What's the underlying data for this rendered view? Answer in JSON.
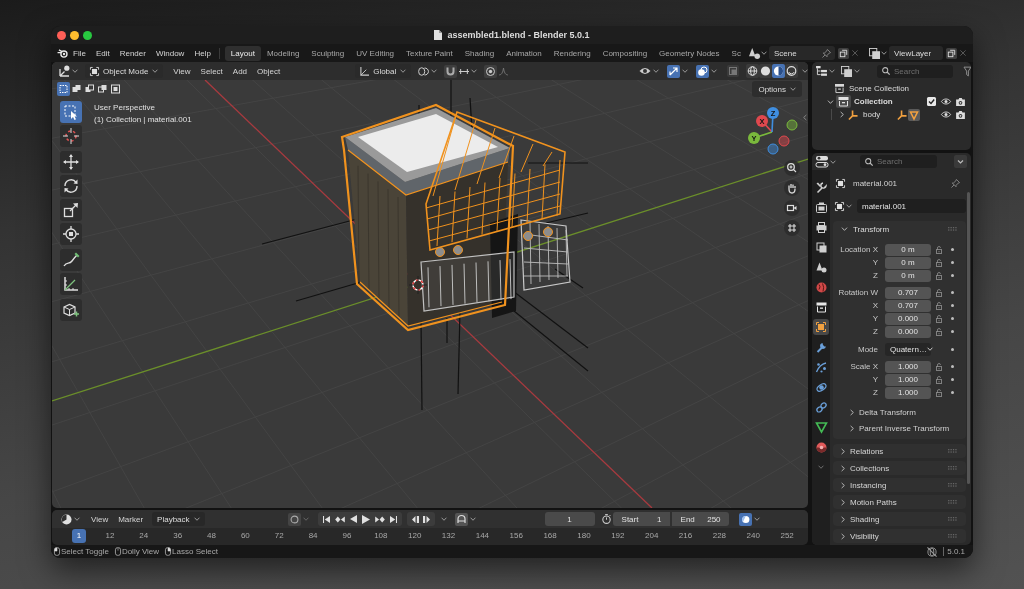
{
  "window": {
    "title": "assembled1.blend - Blender 5.0.1"
  },
  "menu_bar": {
    "menus": [
      "File",
      "Edit",
      "Render",
      "Window",
      "Help"
    ],
    "workspaces": [
      {
        "label": "Layout",
        "selected": true
      },
      {
        "label": "Modeling",
        "selected": false
      },
      {
        "label": "Sculpting",
        "selected": false
      },
      {
        "label": "UV Editing",
        "selected": false
      },
      {
        "label": "Texture Paint",
        "selected": false
      },
      {
        "label": "Shading",
        "selected": false
      },
      {
        "label": "Animation",
        "selected": false
      },
      {
        "label": "Rendering",
        "selected": false
      },
      {
        "label": "Compositing",
        "selected": false
      },
      {
        "label": "Geometry Nodes",
        "selected": false
      },
      {
        "label": "Sc",
        "selected": false
      }
    ],
    "scene": "Scene",
    "view_layer": "ViewLayer"
  },
  "viewport": {
    "header": {
      "mode": "Object Mode",
      "menus": [
        "View",
        "Select",
        "Add",
        "Object"
      ],
      "orientation": "Global",
      "toggles": [
        {
          "kind": "gizmos",
          "on": true
        },
        {
          "kind": "overlays",
          "on": true
        },
        {
          "kind": "xray",
          "on": false
        }
      ],
      "shading_modes": [
        {
          "kind": "wireframe",
          "selected": false
        },
        {
          "kind": "solid",
          "selected": false
        },
        {
          "kind": "material",
          "selected": true
        },
        {
          "kind": "rendered",
          "selected": false
        }
      ]
    },
    "selection_modes": [
      {
        "kind": "set",
        "selected": true
      },
      {
        "kind": "extend",
        "selected": false
      },
      {
        "kind": "subtract",
        "selected": false
      },
      {
        "kind": "invert",
        "selected": false
      },
      {
        "kind": "intersect",
        "selected": false
      }
    ],
    "options": "Options",
    "info": [
      "User Perspective",
      "(1) Collection | material.001"
    ],
    "tool_groups": [
      {
        "tools": [
          {
            "kind": "select-box",
            "selected": true
          },
          {
            "kind": "cursor",
            "selected": false
          }
        ]
      },
      {
        "tools": [
          {
            "kind": "move",
            "selected": false
          },
          {
            "kind": "rotate",
            "selected": false
          },
          {
            "kind": "scale",
            "selected": false
          },
          {
            "kind": "transform",
            "selected": false
          }
        ]
      },
      {
        "tools": [
          {
            "kind": "annotate",
            "selected": false
          },
          {
            "kind": "measure",
            "selected": false
          }
        ]
      },
      {
        "tools": [
          {
            "kind": "add-cube",
            "selected": false
          }
        ]
      }
    ],
    "gizmo_axes": [
      "X",
      "Y",
      "Z"
    ]
  },
  "timeline": {
    "menus": [
      "View",
      "Marker"
    ],
    "playback": "Playback",
    "current_frame": "1",
    "start_label": "Start",
    "start": "1",
    "end_label": "End",
    "end": "250",
    "playhead": "1",
    "ruler": [
      "12",
      "24",
      "36",
      "48",
      "60",
      "72",
      "84",
      "96",
      "108",
      "120",
      "132",
      "144",
      "156",
      "168",
      "180",
      "192",
      "204",
      "216",
      "228",
      "240",
      "252"
    ]
  },
  "outliner": {
    "search": {
      "placeholder": "Search"
    },
    "tree": [
      {
        "kind": "scene_collection",
        "label": "Scene Collection",
        "children": [
          {
            "kind": "collection",
            "label": "Collection",
            "expanded": true,
            "checked": true,
            "children": [
              {
                "kind": "armature",
                "label": "body",
                "expanded": false
              }
            ]
          }
        ]
      }
    ]
  },
  "properties": {
    "search": {
      "placeholder": "Search"
    },
    "tabs": [
      {
        "kind": "tool",
        "selected": false
      },
      {
        "kind": "render",
        "selected": false
      },
      {
        "kind": "output",
        "selected": false
      },
      {
        "kind": "view_layer",
        "selected": false
      },
      {
        "kind": "scene",
        "selected": false
      },
      {
        "kind": "world",
        "selected": false
      },
      {
        "kind": "collection",
        "selected": false
      },
      {
        "kind": "object",
        "selected": true
      },
      {
        "kind": "modifiers",
        "selected": false
      },
      {
        "kind": "particles",
        "selected": false
      },
      {
        "kind": "physics",
        "selected": false
      },
      {
        "kind": "constraints",
        "selected": false
      },
      {
        "kind": "data",
        "selected": false
      },
      {
        "kind": "material",
        "selected": false
      }
    ],
    "object_name": "material.001",
    "datablock": "material.001",
    "transform": {
      "title": "Transform",
      "expanded": true,
      "groups": [
        {
          "rows": [
            {
              "kind": "number",
              "label": "Location X",
              "value": "0 m"
            },
            {
              "kind": "number",
              "label": "Y",
              "value": "0 m"
            },
            {
              "kind": "number",
              "label": "Z",
              "value": "0 m"
            }
          ]
        },
        {
          "rows": [
            {
              "kind": "number",
              "label": "Rotation W",
              "value": "0.707"
            },
            {
              "kind": "number",
              "label": "X",
              "value": "0.707"
            },
            {
              "kind": "number",
              "label": "Y",
              "value": "0.000"
            },
            {
              "kind": "number",
              "label": "Z",
              "value": "0.000"
            }
          ]
        },
        {
          "rows": [
            {
              "kind": "dropdown",
              "label": "Mode",
              "value": "Quatern…"
            }
          ]
        },
        {
          "rows": [
            {
              "kind": "number",
              "label": "Scale X",
              "value": "1.000"
            },
            {
              "kind": "number",
              "label": "Y",
              "value": "1.000"
            },
            {
              "kind": "number",
              "label": "Z",
              "value": "1.000"
            }
          ]
        }
      ],
      "subpanels": [
        {
          "title": "Delta Transform",
          "expanded": false
        },
        {
          "title": "Parent Inverse Transform",
          "expanded": false
        }
      ]
    },
    "panels": [
      {
        "title": "Relations",
        "expanded": false
      },
      {
        "title": "Collections",
        "expanded": false
      },
      {
        "title": "Instancing",
        "expanded": false
      },
      {
        "title": "Motion Paths",
        "expanded": false
      },
      {
        "title": "Shading",
        "expanded": false
      },
      {
        "title": "Visibility",
        "expanded": false
      }
    ]
  },
  "status_bar": {
    "hints": [
      "Select Toggle",
      "Dolly View",
      "Lasso Select"
    ],
    "version": "5.0.1"
  }
}
